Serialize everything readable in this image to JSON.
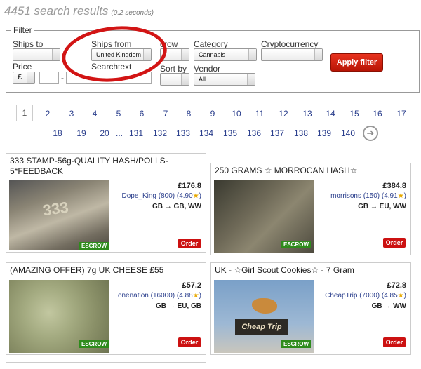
{
  "header": {
    "count_text": "4451 search results",
    "time_text": "(0.2 seconds)"
  },
  "filter": {
    "legend": "Filter",
    "ships_to_label": "Ships to",
    "ships_from_label": "Ships from",
    "ships_from_value": "United Kingdom",
    "escrow_label": "crow",
    "category_label": "Category",
    "category_value": "Cannabis",
    "crypto_label": "Cryptocurrency",
    "price_label": "Price",
    "currency_value": "£",
    "price_sep": "-",
    "searchtext_label": "Searchtext",
    "sortby_label": "Sort by",
    "vendor_label": "Vendor",
    "vendor_value": "All",
    "apply_label": "Apply filter"
  },
  "pagination": {
    "row1": [
      "1",
      "2",
      "3",
      "4",
      "5",
      "6",
      "7",
      "8",
      "9",
      "10",
      "11",
      "12",
      "13",
      "14",
      "15",
      "16",
      "17"
    ],
    "row2": [
      "18",
      "19",
      "20",
      "...",
      "131",
      "132",
      "133",
      "134",
      "135",
      "136",
      "137",
      "138",
      "139",
      "140"
    ],
    "next_icon": "arrow-right-circle-icon"
  },
  "listings": [
    {
      "title": "333 STAMP-56g-QUALITY HASH/POLLS-5*FEEDBACK",
      "price": "£176.8",
      "seller": "Dope_King (800) (4.90",
      "shipping": "GB → GB, WW",
      "order": "Order",
      "escrow": "ESCROW"
    },
    {
      "title": "250 GRAMS ☆ MORROCAN HASH☆",
      "price": "£384.8",
      "seller": "morrisons (150) (4.91",
      "shipping": "GB → EU, WW",
      "order": "Order",
      "escrow": "ESCROW"
    },
    {
      "title": "(AMAZING OFFER) 7g UK CHEESE £55",
      "price": "£57.2",
      "seller": "onenation (16000) (4.88",
      "shipping": "GB → EU, GB",
      "order": "Order",
      "escrow": "ESCROW"
    },
    {
      "title": "UK - ☆Girl Scout Cookies☆ - 7 Gram",
      "price": "£72.8",
      "seller": "CheapTrip (7000) (4.85",
      "shipping": "GB → WW",
      "order": "Order",
      "escrow": "ESCROW"
    }
  ],
  "image_labels": {
    "stamp": "333",
    "cheaptrip": "Cheap Trip"
  },
  "colors": {
    "accent_red": "#cc1111",
    "link_blue": "#2a3e8c",
    "escrow_green": "#2e8b1c"
  }
}
